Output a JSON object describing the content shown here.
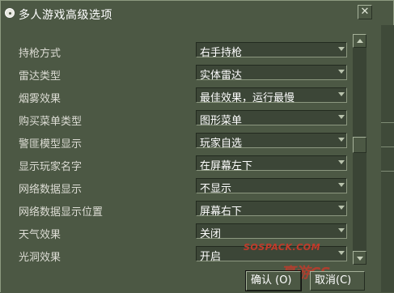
{
  "window": {
    "title": "多人游戏高级选项",
    "close_label": "✕"
  },
  "options": [
    {
      "label": "持枪方式",
      "value": "右手持枪"
    },
    {
      "label": "雷达类型",
      "value": "实体雷达"
    },
    {
      "label": "烟雾效果",
      "value": "最佳效果，运行最慢"
    },
    {
      "label": "购买菜单类型",
      "value": "图形菜单"
    },
    {
      "label": "警匪模型显示",
      "value": "玩家自选"
    },
    {
      "label": "显示玩家名字",
      "value": "在屏幕左下"
    },
    {
      "label": "网络数据显示",
      "value": "不显示"
    },
    {
      "label": "网络数据显示位置",
      "value": "屏幕右下"
    },
    {
      "label": "天气效果",
      "value": "关闭"
    },
    {
      "label": "光洞效果",
      "value": "开启"
    }
  ],
  "buttons": {
    "ok": "确认 (O)",
    "cancel": "取消(C)"
  },
  "watermark": {
    "site": "SOSPACK.COM",
    "logo_text": "豪游CS"
  },
  "colors": {
    "background": "#4c5844",
    "text": "#ffffff",
    "field": "#3c4637"
  }
}
